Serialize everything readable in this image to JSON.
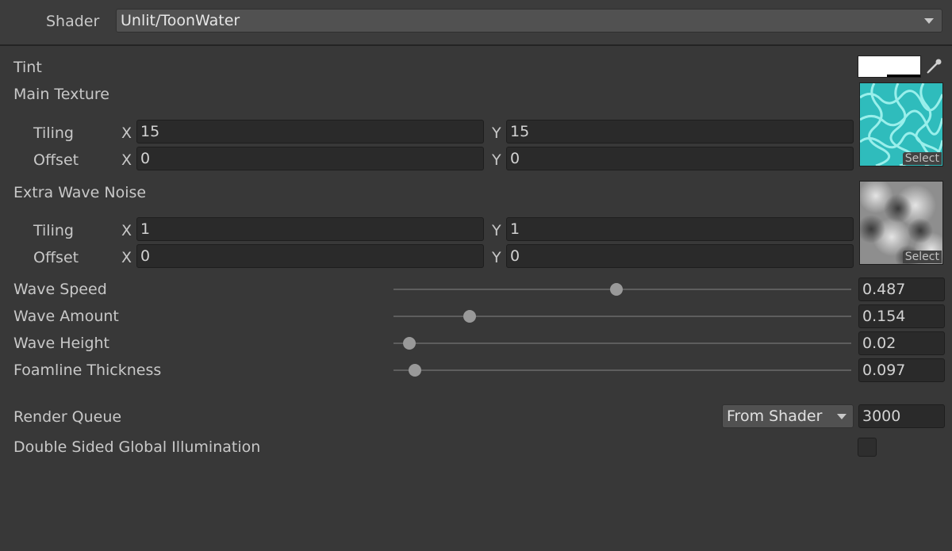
{
  "shader": {
    "label": "Shader",
    "value": "Unlit/ToonWater"
  },
  "tint": {
    "label": "Tint",
    "color": "#ffffff"
  },
  "main_texture": {
    "label": "Main Texture",
    "tiling_label": "Tiling",
    "offset_label": "Offset",
    "tiling_x": "15",
    "tiling_y": "15",
    "offset_x": "0",
    "offset_y": "0",
    "select_label": "Select",
    "thumb_colors": [
      "#2fbcbc",
      "#9ff2ee"
    ]
  },
  "extra_wave_noise": {
    "label": "Extra Wave Noise",
    "tiling_label": "Tiling",
    "offset_label": "Offset",
    "tiling_x": "1",
    "tiling_y": "1",
    "offset_x": "0",
    "offset_y": "0",
    "select_label": "Select",
    "thumb_colors": [
      "#5a5a5a",
      "#e4e4e4"
    ]
  },
  "axes": {
    "x": "X",
    "y": "Y"
  },
  "sliders": [
    {
      "label": "Wave Speed",
      "value": "0.487",
      "fraction": 0.487
    },
    {
      "label": "Wave Amount",
      "value": "0.154",
      "fraction": 0.167
    },
    {
      "label": "Wave Height",
      "value": "0.02",
      "fraction": 0.035
    },
    {
      "label": "Foamline Thickness",
      "value": "0.097",
      "fraction": 0.046
    }
  ],
  "render_queue": {
    "label": "Render Queue",
    "mode": "From Shader",
    "value": "3000"
  },
  "double_sided_gi": {
    "label": "Double Sided Global Illumination",
    "checked": false
  },
  "colors": {
    "background": "#383838",
    "field": "#2a2a2a",
    "text": "#c8c8c8"
  }
}
